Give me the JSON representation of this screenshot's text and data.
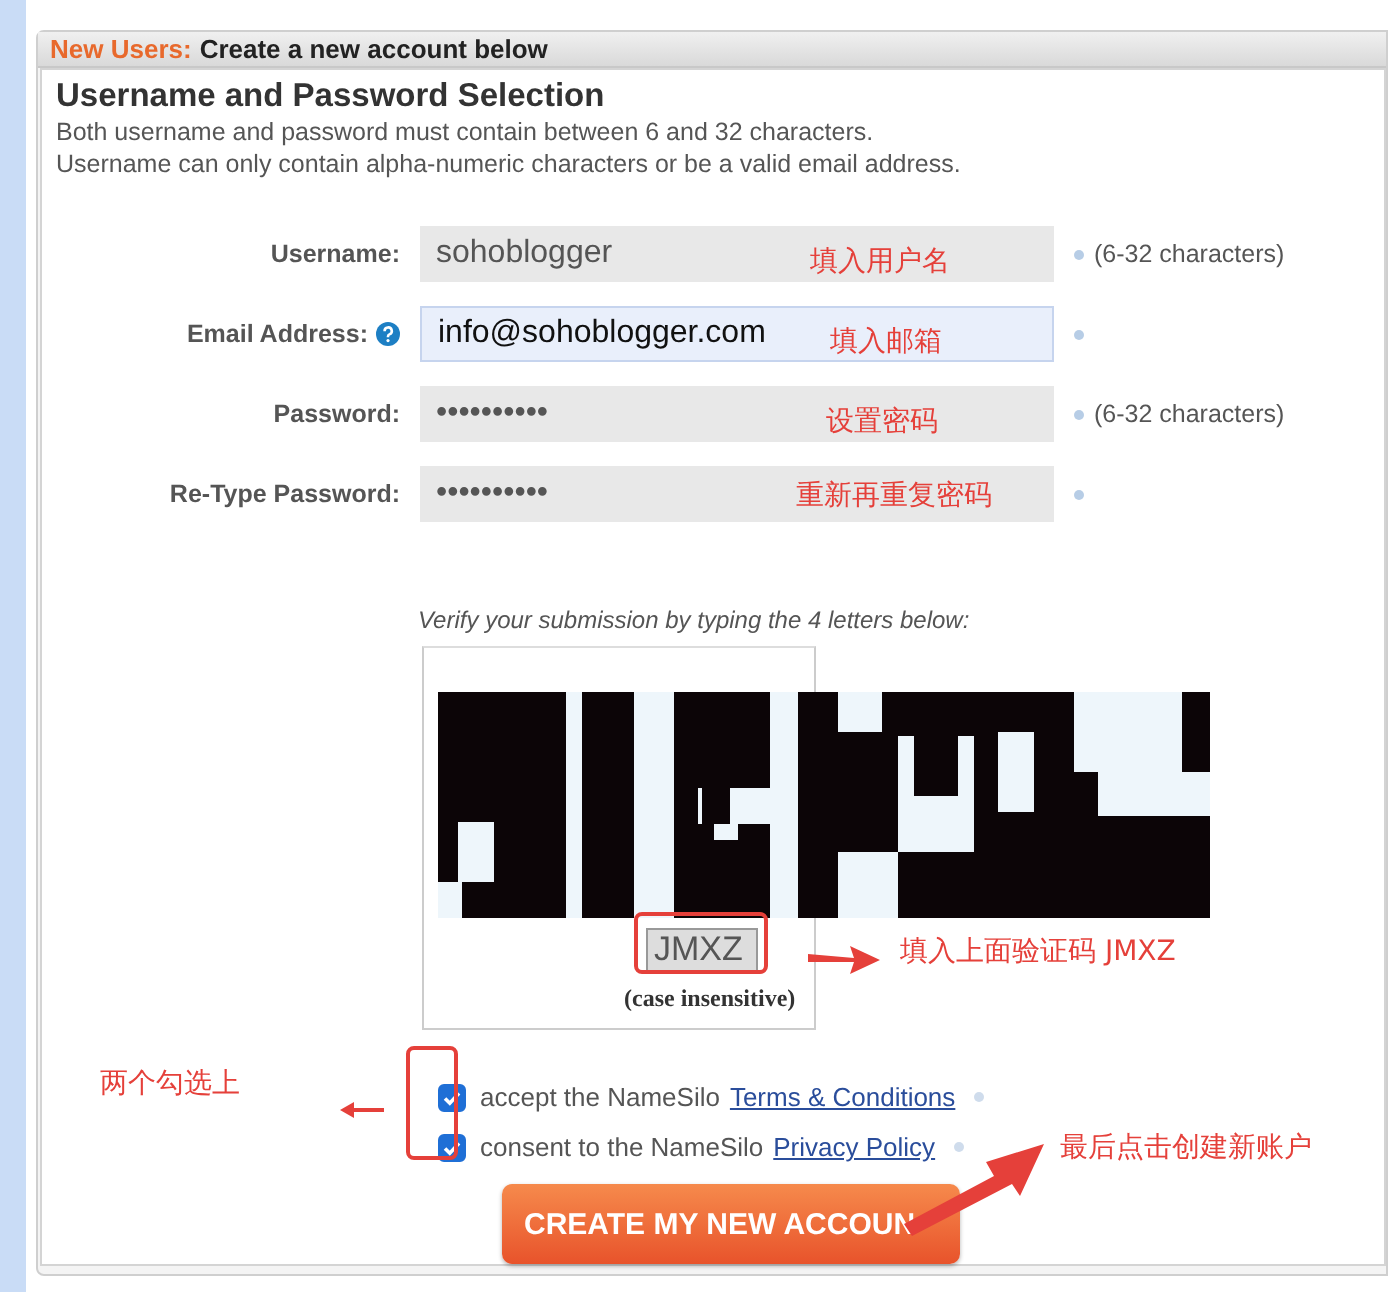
{
  "header": {
    "prefix": "New Users:",
    "title": "Create a new account below"
  },
  "section": {
    "heading": "Username and Password Selection",
    "notes": [
      "Both username and password must contain between 6 and 32 characters.",
      "Username can only contain alpha-numeric characters or be a valid email address."
    ]
  },
  "fields": [
    {
      "label": "Username:",
      "value": "sohoblogger",
      "help": false,
      "focused": false,
      "required": true,
      "hint": "(6-32 characters)"
    },
    {
      "label": "Email Address:",
      "value": "info@sohoblogger.com",
      "help": true,
      "focused": true,
      "required": true
    },
    {
      "label": "Password:",
      "value": "••••••••••",
      "help": false,
      "focused": false,
      "required": true,
      "hint": "(6-32 characters)"
    },
    {
      "label": "Re-Type Password:",
      "value": "••••••••••",
      "help": false,
      "focused": false,
      "required": true
    }
  ],
  "captcha": {
    "prompt": "Verify your submission by typing the 4 letters below:",
    "value": "JMXZ",
    "note": "(case insensitive)"
  },
  "agreements": [
    {
      "checked": true,
      "text": "accept the NameSilo",
      "link": "Terms & Conditions"
    },
    {
      "checked": true,
      "text": "consent to the NameSilo",
      "link": "Privacy Policy"
    }
  ],
  "submit": {
    "label": "CREATE MY NEW ACCOUN"
  },
  "annotations": [
    {
      "text": "填入用户名"
    },
    {
      "text": "填入邮箱"
    },
    {
      "text": "设置密码"
    },
    {
      "text": "重新再重复密码"
    },
    {
      "text": "填入上面验证码 JMXZ"
    },
    {
      "text": "两个勾选上"
    },
    {
      "text": "最后点击创建新账户"
    }
  ]
}
